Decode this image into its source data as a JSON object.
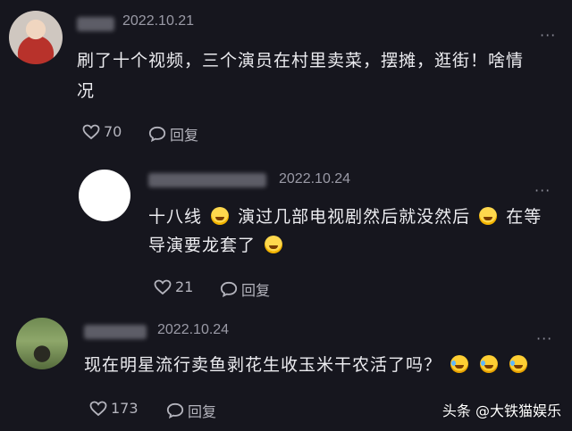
{
  "comments": [
    {
      "date": "2022.10.21",
      "text_line1": "刷了十个视频，三个演员在村里卖菜，摆摊，逛街！啥情",
      "text_line2": "况",
      "likes": "70",
      "reply_label": "回复"
    },
    {
      "date": "2022.10.24",
      "text_a": "十八线",
      "text_b": "演过几部电视剧然后就没然后",
      "text_c": "在等",
      "text_line2": "导演要龙套了",
      "likes": "21",
      "reply_label": "回复"
    },
    {
      "date": "2022.10.24",
      "text_line1": "现在明星流行卖鱼剥花生收玉米干农活了吗？",
      "likes": "173",
      "reply_label": "回复"
    }
  ],
  "more_menu_glyph": "···",
  "watermark": "头条 @大铁猫娱乐",
  "icons": {
    "like": "heart-outline-icon",
    "reply": "speech-bubble-icon",
    "emoji_shy": "blushing-face-emoji",
    "emoji_laugh": "laughing-face-emoji"
  }
}
